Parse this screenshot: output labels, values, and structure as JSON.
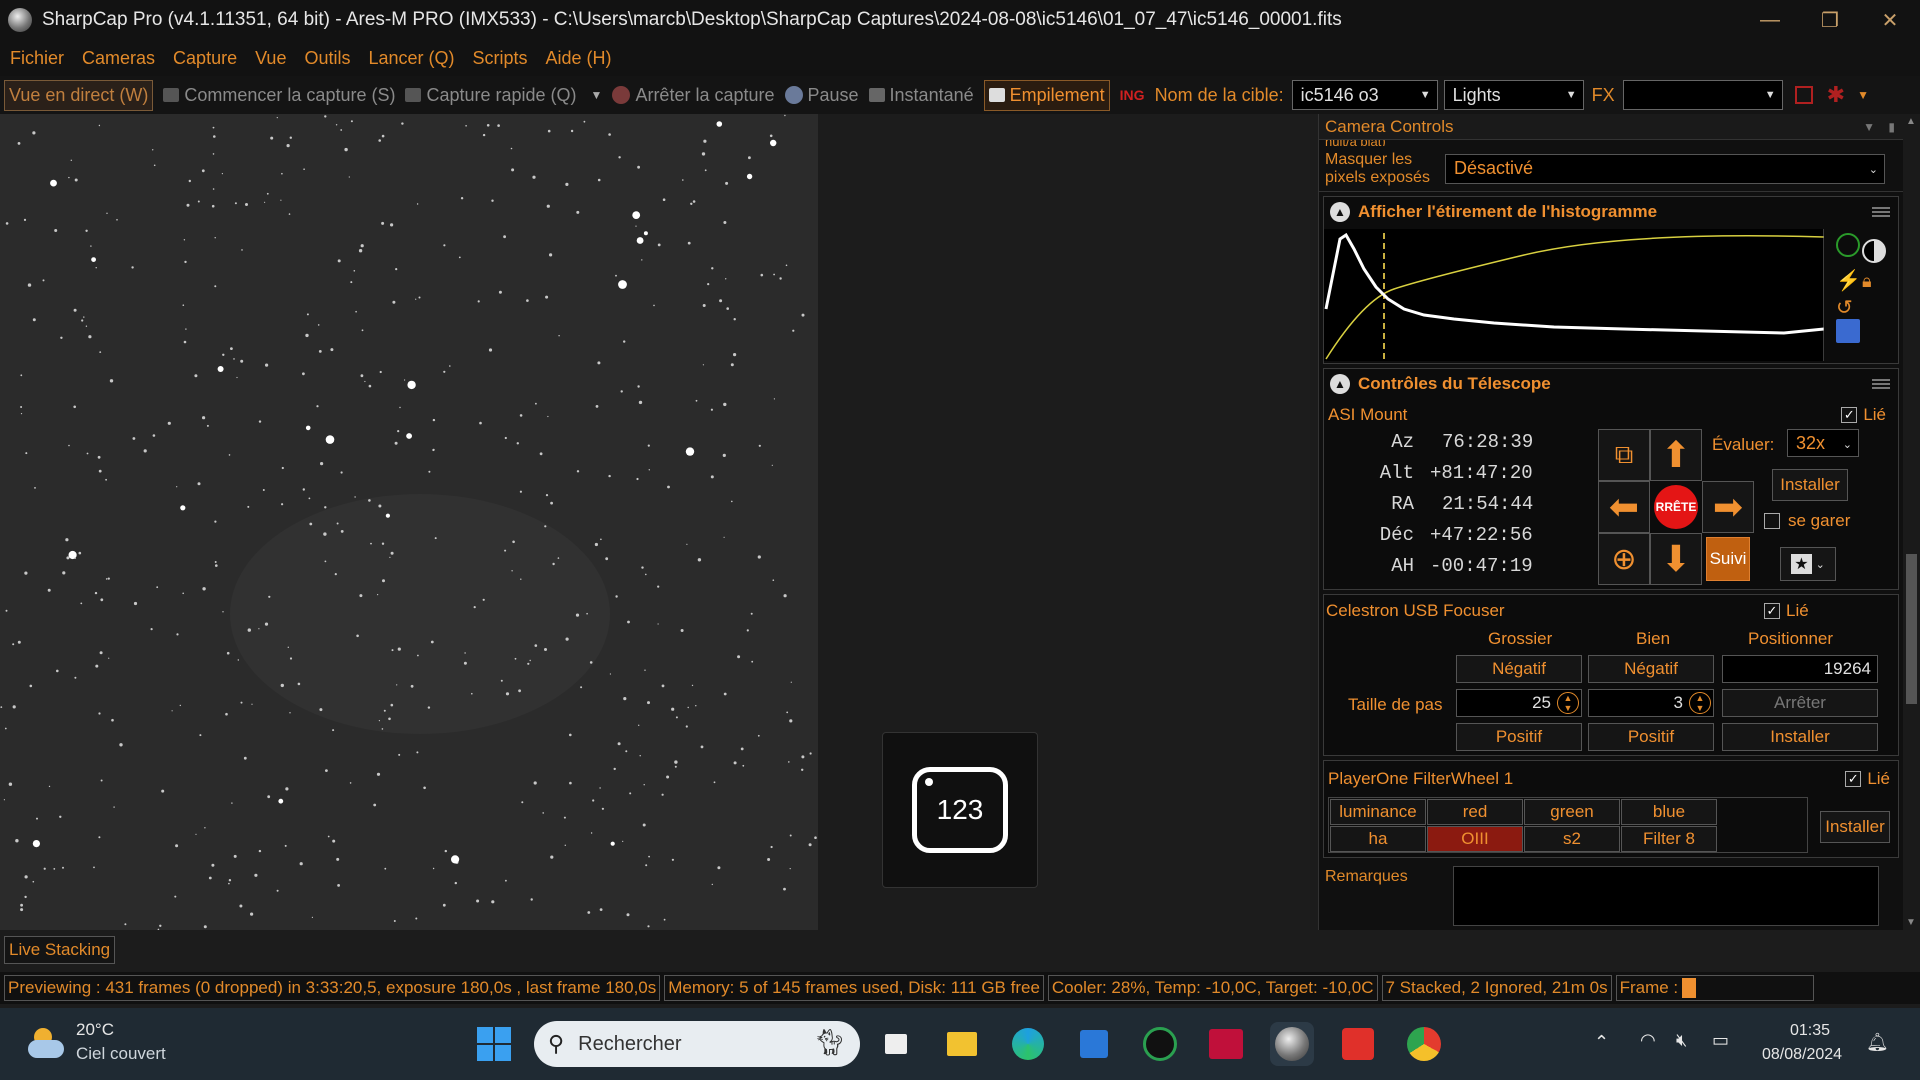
{
  "window": {
    "title": "SharpCap Pro (v4.1.11351, 64 bit) - Ares-M PRO (IMX533) - C:\\Users\\marcb\\Desktop\\SharpCap Captures\\2024-08-08\\ic5146\\01_07_47\\ic5146_00001.fits",
    "minimize": "—",
    "restore": "❐",
    "close": "✕"
  },
  "menu": [
    "Fichier",
    "Cameras",
    "Capture",
    "Vue",
    "Outils",
    "Lancer (Q)",
    "Scripts",
    "Aide (H)"
  ],
  "toolbar": {
    "live_view": "Vue en direct (W)",
    "start_capture": "Commencer la capture (S)",
    "quick_capture": "Capture rapide (Q)",
    "stop_capture": "Arrêter la capture",
    "pause": "Pause",
    "snapshot": "Instantané",
    "stacking": "Empilement",
    "target_label": "Nom de la cible:",
    "target_value": "ic5146 o3",
    "frame_type": "Lights",
    "fx_label": "FX",
    "fx_value": ""
  },
  "overlay": {
    "value": "123"
  },
  "panel": {
    "header": "Camera Controls",
    "partial_row": "nuit/à plat)",
    "mask_label": "Masquer les pixels exposés",
    "mask_value": "Désactivé",
    "histogram": {
      "title": "Afficher l'étirement de l'histogramme"
    },
    "telescope": {
      "title": "Contrôles du Télescope",
      "mount_name": "ASI Mount",
      "linked_label": "Lié",
      "rows": [
        {
          "label": "Az",
          "value": "76:28:39"
        },
        {
          "label": "Alt",
          "value": "+81:47:20"
        },
        {
          "label": "RA",
          "value": "21:54:44"
        },
        {
          "label": "Déc",
          "value": "+47:22:56"
        },
        {
          "label": "AH",
          "value": "-00:47:19"
        }
      ],
      "rate_label": "Évaluer:",
      "rate_value": "32x",
      "install_button": "Installer",
      "park_label": "se garer",
      "stop_button": "RRÊTE",
      "tracking_button": "Suivi"
    },
    "focuser": {
      "name": "Celestron USB Focuser",
      "linked_label": "Lié",
      "col_coarse": "Grossier",
      "col_fine": "Bien",
      "col_position": "Positionner",
      "negative": "Négatif",
      "positive": "Positif",
      "step_label": "Taille de pas",
      "coarse_step": "25",
      "fine_step": "3",
      "position_value": "19264",
      "stop_button": "Arrêter",
      "install_button": "Installer"
    },
    "filterwheel": {
      "name": "PlayerOne FilterWheel 1",
      "linked_label": "Lié",
      "filters": [
        "luminance",
        "red",
        "green",
        "blue",
        "ha",
        "OIII",
        "s2",
        "Filter 8"
      ],
      "selected": "OIII",
      "install_button": "Installer"
    },
    "notes_label": "Remarques"
  },
  "live_stacking_tab": "Live Stacking",
  "status": {
    "preview": "Previewing : 431 frames (0 dropped) in 3:33:20,5, exposure 180,0s , last frame 180,0s",
    "memory": "Memory: 5 of 145 frames used, Disk: 111 GB free",
    "cooler": "Cooler: 28%, Temp: -10,0C, Target: -10,0C",
    "stacked": "7 Stacked, 2 Ignored, 21m 0s",
    "frame_label": "Frame :"
  },
  "taskbar": {
    "weather_temp": "20°C",
    "weather_desc": "Ciel couvert",
    "search_placeholder": "Rechercher",
    "time": "01:35",
    "date": "08/08/2024"
  },
  "colors": {
    "accent": "#f09030",
    "selected_filter": "#8b1a10"
  }
}
